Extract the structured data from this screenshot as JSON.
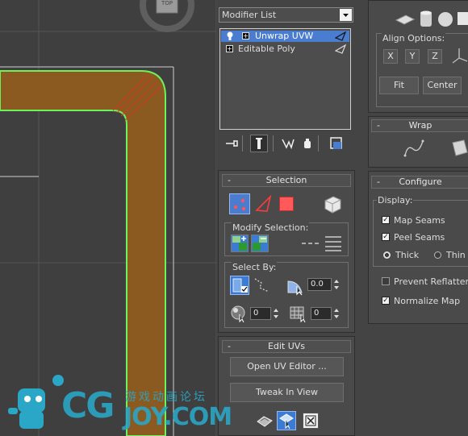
{
  "viewport": {
    "nav_cube_label": "TOP",
    "object_fill": "#8a5a20",
    "selection_edge_color": "#6cf25a",
    "grid_color": "#555555"
  },
  "modifier_stack": {
    "dropdown_label": "Modifier List",
    "items": [
      {
        "label": "Unwrap UVW",
        "selected": true
      },
      {
        "label": "Editable Poly",
        "selected": false
      }
    ]
  },
  "selection": {
    "title": "Selection",
    "minus": "-",
    "modify_selection_label": "Modify Selection:",
    "select_by_label": "Select By:",
    "angle_value": "0.0",
    "spin1_value": "0",
    "spin2_value": "0"
  },
  "edit_uvs": {
    "title": "Edit UVs",
    "minus": "-",
    "open_uv_editor": "Open UV Editor ...",
    "tweak_in_view": "Tweak In View"
  },
  "right_panel": {
    "align_options_label": "Align Options:",
    "align_x": "X",
    "align_y": "Y",
    "align_z": "Z",
    "fit_button": "Fit",
    "center_button": "Center",
    "wrap_title": "Wrap",
    "configure_title": "Configure",
    "minus": "-",
    "display_label": "Display:",
    "map_seams": {
      "label": "Map Seams",
      "checked": true
    },
    "peel_seams": {
      "label": "Peel Seams",
      "checked": true
    },
    "thick_label": "Thick",
    "thin_label": "Thin",
    "prevent_reflattening": {
      "label": "Prevent Reflattening",
      "checked": false
    },
    "normalize_map": {
      "label": "Normalize Map",
      "checked": true
    }
  },
  "watermark": {
    "text": "CGJOY.COM",
    "cn_text": "游戏动画论坛",
    "color": "#2aa6c6"
  }
}
